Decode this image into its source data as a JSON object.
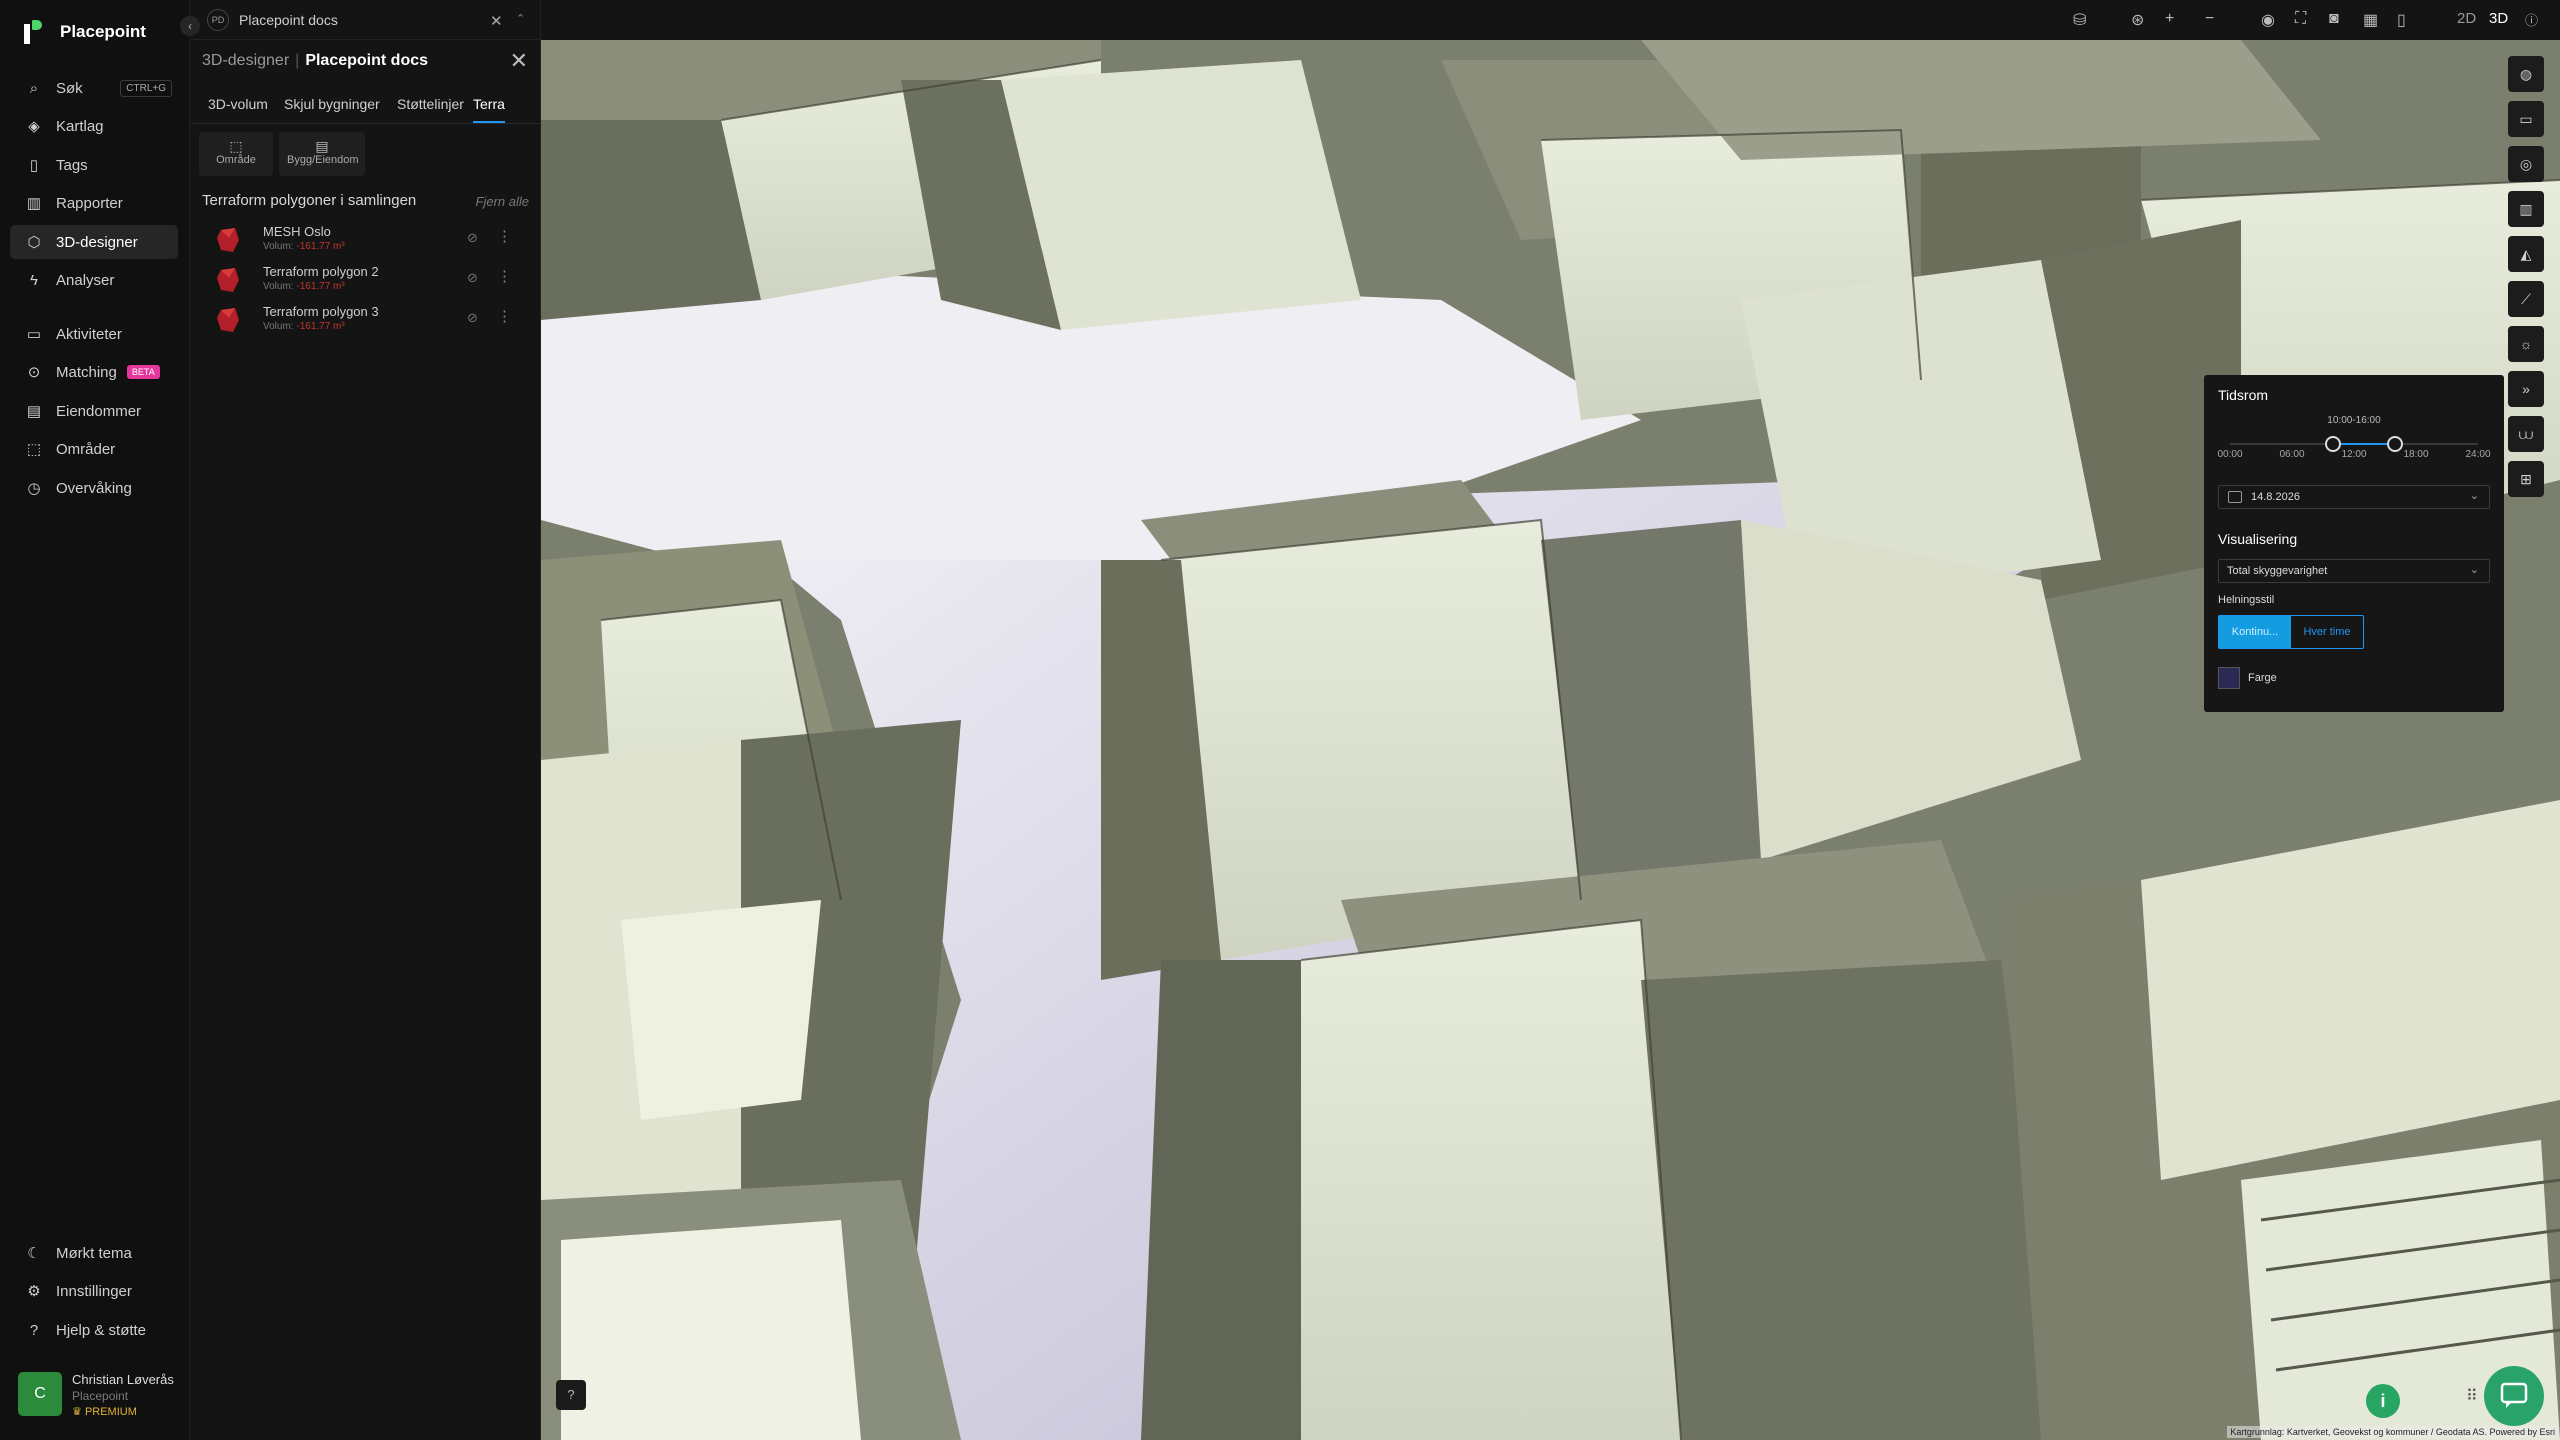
{
  "app": {
    "name": "Placepoint",
    "collapse_icon": "‹"
  },
  "nav": {
    "items": [
      {
        "label": "Søk",
        "icon": "search-icon",
        "glyph": "⌕",
        "kbd": "CTRL+G"
      },
      {
        "label": "Kartlag",
        "icon": "layers-icon",
        "glyph": "◈"
      },
      {
        "label": "Tags",
        "icon": "bookmark-icon",
        "glyph": "▯"
      },
      {
        "label": "Rapporter",
        "icon": "chart-icon",
        "glyph": "▥"
      },
      {
        "label": "3D-designer",
        "icon": "cube-icon",
        "glyph": "⬡",
        "active": true
      },
      {
        "label": "Analyser",
        "icon": "bolt-icon",
        "glyph": "ϟ"
      },
      {
        "label": "Aktiviteter",
        "icon": "chat-icon",
        "glyph": "▭"
      },
      {
        "label": "Matching",
        "icon": "match-icon",
        "glyph": "⊙",
        "badge": "BETA"
      },
      {
        "label": "Eiendommer",
        "icon": "building-icon",
        "glyph": "▤"
      },
      {
        "label": "Områder",
        "icon": "area-icon",
        "glyph": "⬚"
      },
      {
        "label": "Overvåking",
        "icon": "monitor-icon",
        "glyph": "◷"
      }
    ],
    "bottom": [
      {
        "label": "Mørkt tema",
        "icon": "moon-icon",
        "glyph": "☾"
      },
      {
        "label": "Innstillinger",
        "icon": "gear-icon",
        "glyph": "⚙"
      },
      {
        "label": "Hjelp & støtte",
        "icon": "help-icon",
        "glyph": "?"
      }
    ]
  },
  "user": {
    "initial": "C",
    "name": "Christian Løverås",
    "org": "Placepoint",
    "plan": "PREMIUM"
  },
  "doc": {
    "badge": "PD",
    "name": "Placepoint docs"
  },
  "panel": {
    "module": "3D-designer",
    "doc": "Placepoint docs",
    "tabs": [
      "3D-volum",
      "Skjul bygninger",
      "Støttelinjer",
      "Terra"
    ],
    "active_tab": "Terra",
    "subtabs": [
      "Område",
      "Bygg/Eiendom"
    ],
    "section_title": "Terraform polygoner i samlingen",
    "remove_all": "Fjern alle",
    "polygons": [
      {
        "name": "MESH Oslo",
        "volume_label": "Volum:",
        "volume": "-161.77 m³"
      },
      {
        "name": "Terraform polygon 2",
        "volume_label": "Volum:",
        "volume": "-161.77 m³"
      },
      {
        "name": "Terraform polygon 3",
        "volume_label": "Volum:",
        "volume": "-161.77 m³"
      }
    ]
  },
  "topbar": {
    "mode_2d": "2D",
    "mode_3d": "3D",
    "active_mode": "3D"
  },
  "shadow": {
    "title": "Tidsrom",
    "range_label": "10:00-16:00",
    "range_start_fraction": 0.4167,
    "range_end_fraction": 0.6667,
    "ticks": [
      "00:00",
      "06:00",
      "12:00",
      "18:00",
      "24:00"
    ],
    "date": "14.8.2026",
    "vis_title": "Visualisering",
    "vis_value": "Total skyggevarighet",
    "style_title": "Helningsstil",
    "style_options": [
      "Kontinu...",
      "Hver time"
    ],
    "style_active": "Kontinu...",
    "color_label": "Farge"
  },
  "attribution": "Kartgrunnlag: Kartverket, Geovekst og kommuner / Geodata AS. Powered by Esri",
  "colors": {
    "accent": "#2196f3",
    "beta": "#e5379b",
    "brand_green": "#2c8a3c",
    "polygon_red": "#b3202a",
    "premium": "#e3b33a"
  }
}
